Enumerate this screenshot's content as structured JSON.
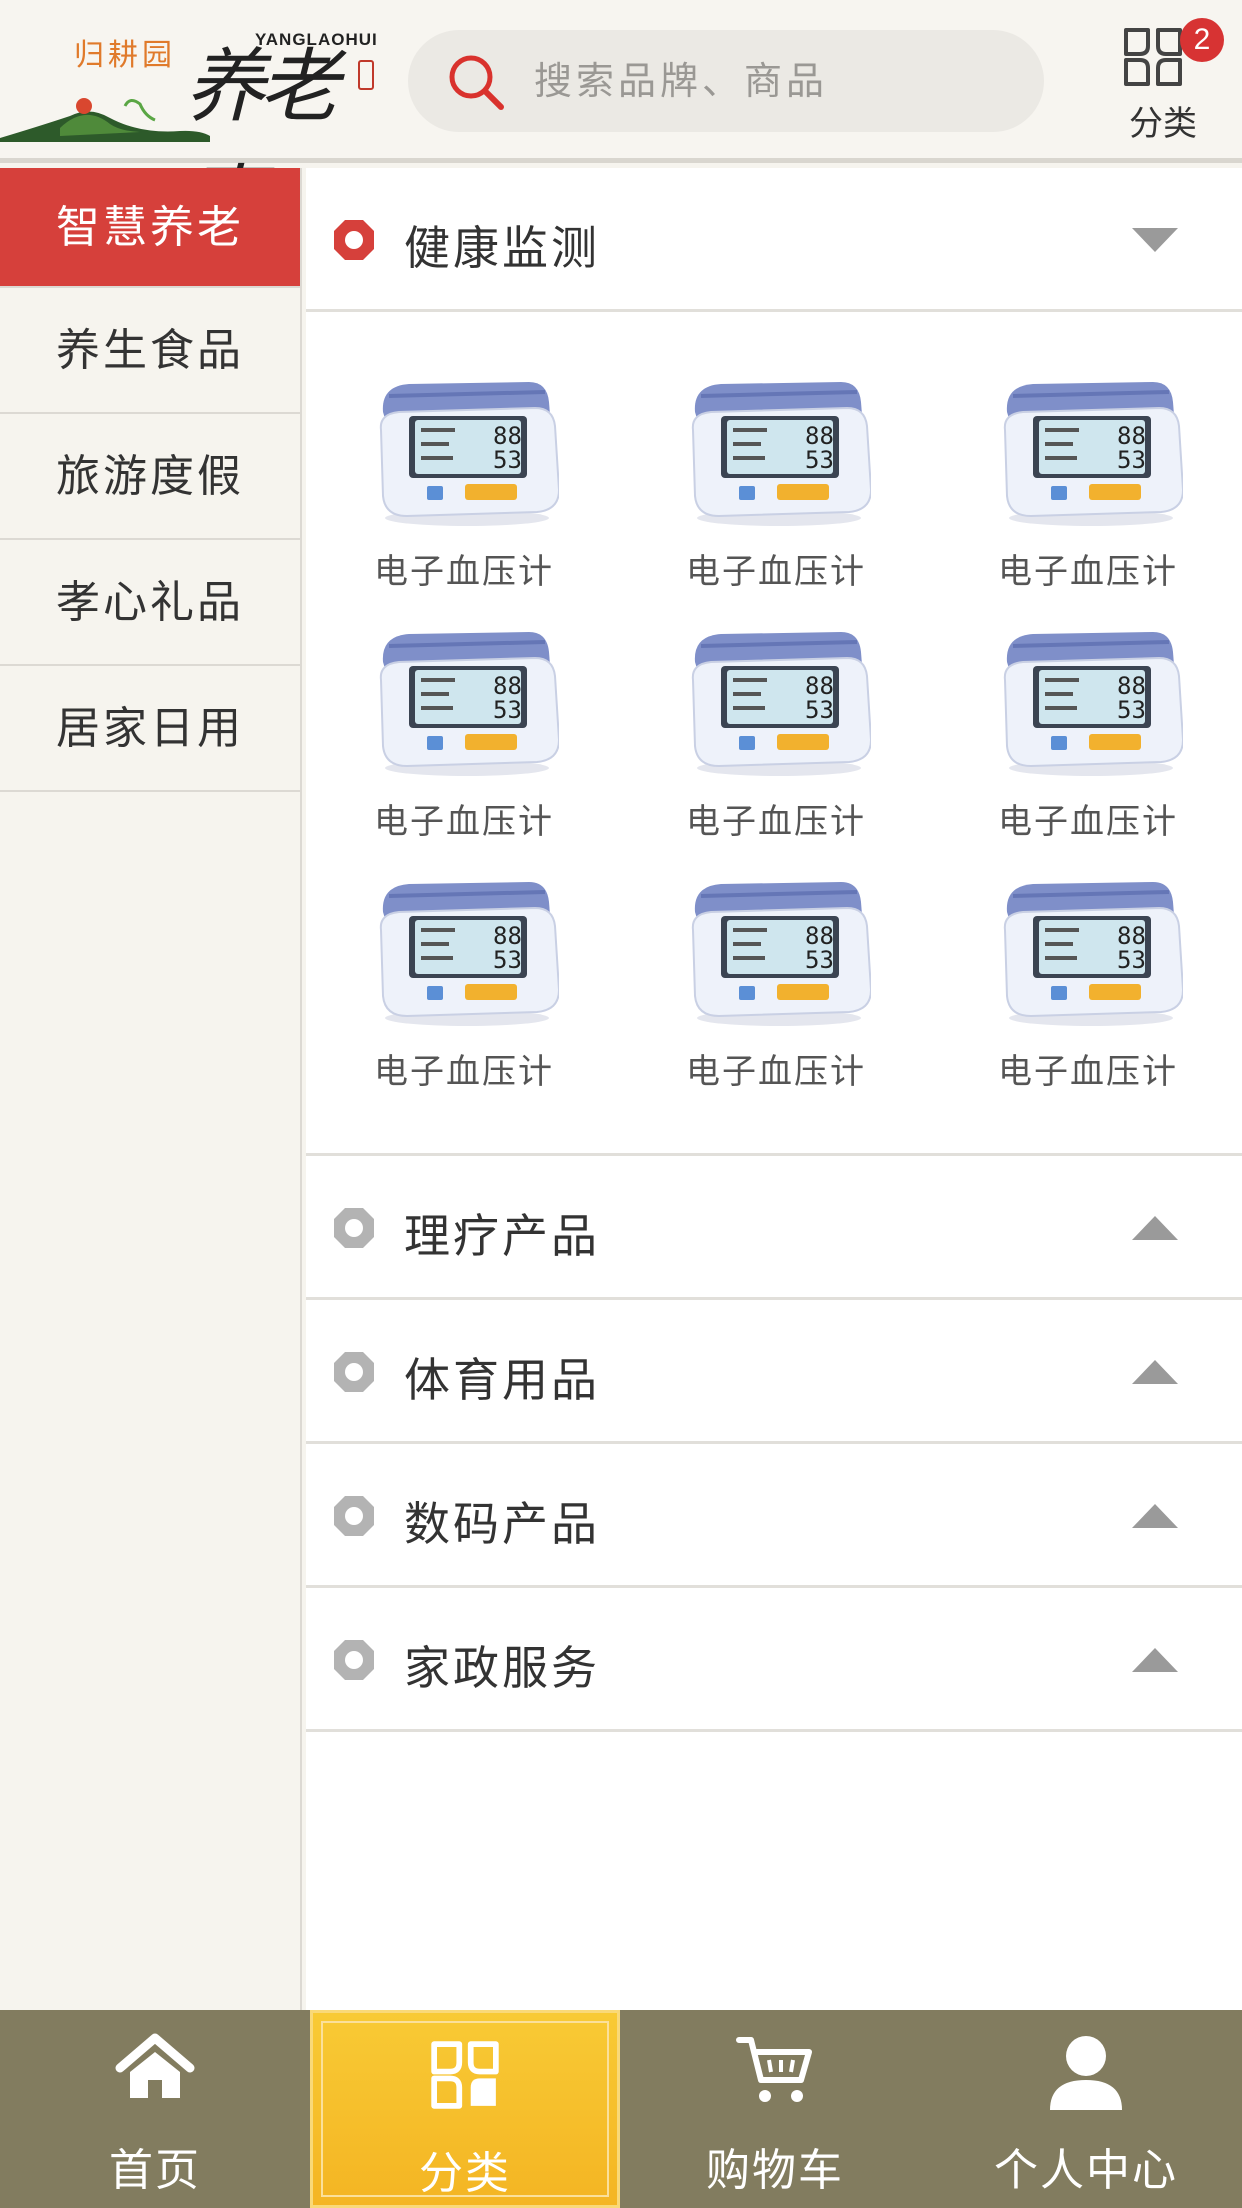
{
  "header": {
    "brand_small": "归耕园",
    "brand_big": "养老惠",
    "brand_en": "YANGLAOHUI",
    "search_placeholder": "搜索品牌、商品",
    "category_label": "分类",
    "category_badge": "2"
  },
  "sidebar": {
    "items": [
      {
        "label": "智慧养老",
        "active": true
      },
      {
        "label": "养生食品",
        "active": false
      },
      {
        "label": "旅游度假",
        "active": false
      },
      {
        "label": "孝心礼品",
        "active": false
      },
      {
        "label": "居家日用",
        "active": false
      }
    ]
  },
  "main": {
    "expanded_section": {
      "title": "健康监测",
      "products": [
        "电子血压计",
        "电子血压计",
        "电子血压计",
        "电子血压计",
        "电子血压计",
        "电子血压计",
        "电子血压计",
        "电子血压计",
        "电子血压计"
      ]
    },
    "collapsed_sections": [
      "理疗产品",
      "体育用品",
      "数码产品",
      "家政服务"
    ]
  },
  "bottom_nav": {
    "items": [
      {
        "label": "首页",
        "icon": "home-icon",
        "active": false
      },
      {
        "label": "分类",
        "icon": "category-icon",
        "active": true
      },
      {
        "label": "购物车",
        "icon": "cart-icon",
        "active": false
      },
      {
        "label": "个人中心",
        "icon": "user-icon",
        "active": false
      }
    ]
  },
  "colors": {
    "accent_red": "#d6403b",
    "nav_bg": "#827c5f",
    "nav_active": "#f6bd2a"
  }
}
